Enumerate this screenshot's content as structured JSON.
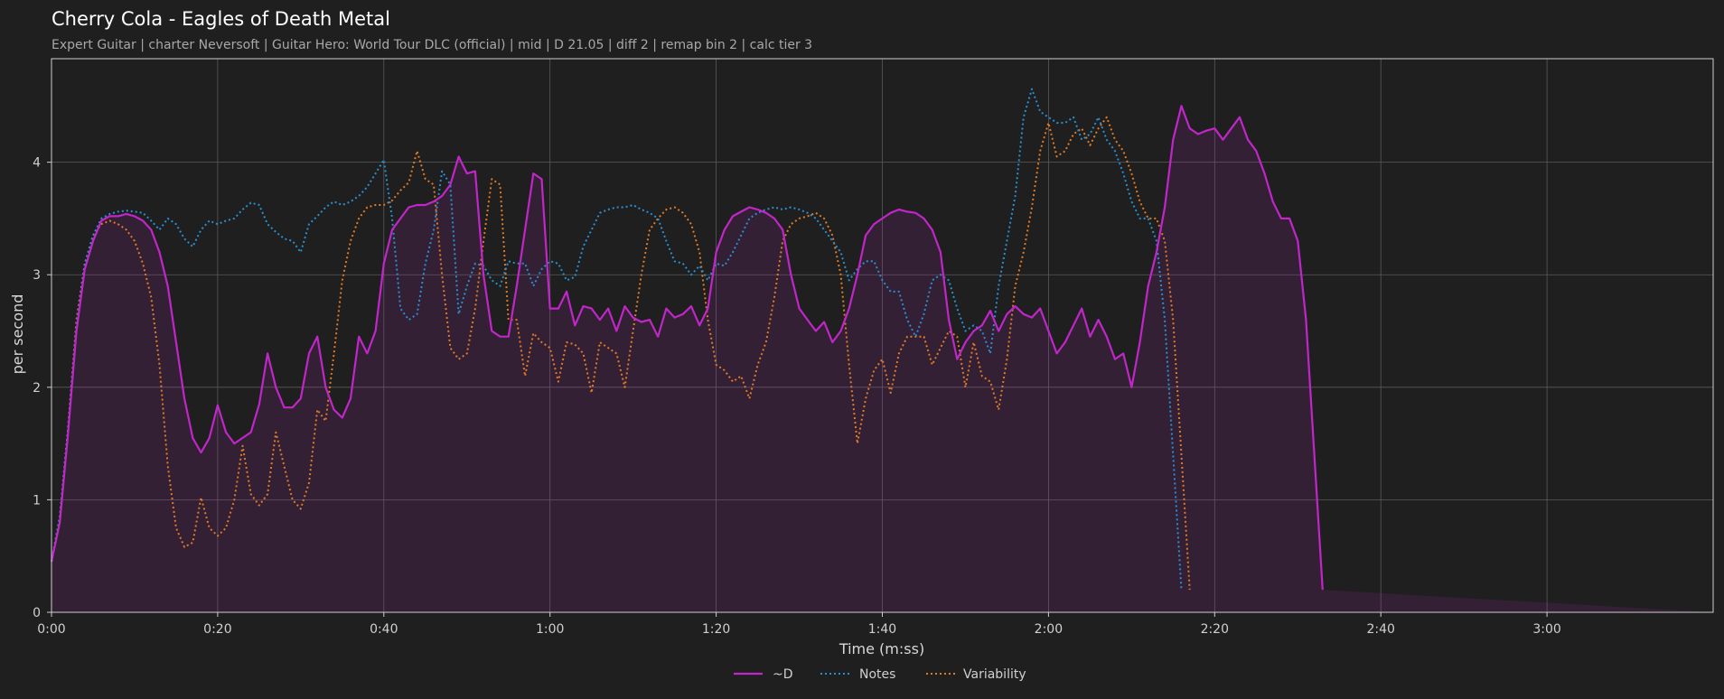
{
  "chart_data": {
    "type": "line",
    "title": "Cherry Cola - Eagles of Death Metal",
    "subtitle": "Expert Guitar  |  charter Neversoft  |  Guitar Hero: World Tour DLC (official)  |  mid  |  D 21.05  |  diff 2  |  remap bin 2  |  calc tier 3",
    "xlabel": "Time (m:ss)",
    "ylabel": "per second",
    "xlim": [
      0,
      200
    ],
    "ylim": [
      0,
      4.92
    ],
    "xticks": [
      0,
      20,
      40,
      60,
      80,
      100,
      120,
      140,
      160,
      180
    ],
    "xtick_labels": [
      "0:00",
      "0:20",
      "0:40",
      "1:00",
      "1:20",
      "1:40",
      "2:00",
      "2:20",
      "2:40",
      "3:00"
    ],
    "yticks": [
      0,
      1,
      2,
      3,
      4
    ],
    "ytick_labels": [
      "0",
      "1",
      "2",
      "3",
      "4"
    ],
    "grid": true,
    "legend_position": "bottom-center",
    "x": [
      0,
      1,
      2,
      3,
      4,
      5,
      6,
      7,
      8,
      9,
      10,
      11,
      12,
      13,
      14,
      15,
      16,
      17,
      18,
      19,
      20,
      21,
      22,
      23,
      24,
      25,
      26,
      27,
      28,
      29,
      30,
      31,
      32,
      33,
      34,
      35,
      36,
      37,
      38,
      39,
      40,
      41,
      42,
      43,
      44,
      45,
      46,
      47,
      48,
      49,
      50,
      51,
      52,
      53,
      54,
      55,
      56,
      57,
      58,
      59,
      60,
      61,
      62,
      63,
      64,
      65,
      66,
      67,
      68,
      69,
      70,
      71,
      72,
      73,
      74,
      75,
      76,
      77,
      78,
      79,
      80,
      81,
      82,
      83,
      84,
      85,
      86,
      87,
      88,
      89,
      90,
      91,
      92,
      93,
      94,
      95,
      96,
      97,
      98,
      99,
      100,
      101,
      102,
      103,
      104,
      105,
      106,
      107,
      108,
      109,
      110,
      111,
      112,
      113,
      114,
      115,
      116,
      117,
      118,
      119,
      120,
      121,
      122,
      123,
      124,
      125,
      126,
      127,
      128,
      129,
      130,
      131,
      132,
      133,
      134,
      135,
      136,
      137,
      138,
      139,
      140,
      141,
      142,
      143,
      144,
      145,
      146,
      147,
      148,
      149,
      150,
      151,
      152,
      153,
      154,
      155,
      156,
      157,
      158,
      159,
      160,
      161,
      162,
      163,
      164,
      165,
      166,
      167,
      168,
      169,
      170,
      171,
      172,
      173,
      174,
      175,
      176,
      177,
      178,
      179,
      180,
      181,
      182,
      183,
      184,
      185,
      186,
      187,
      188,
      189,
      190,
      191,
      192,
      193,
      194,
      195,
      196,
      197,
      198,
      199,
      200
    ],
    "series": [
      {
        "name": "~D",
        "color": "#c026c8",
        "style": "solid",
        "values": [
          0.45,
          0.8,
          1.6,
          2.5,
          3.05,
          3.3,
          3.48,
          3.52,
          3.52,
          3.54,
          3.52,
          3.48,
          3.4,
          3.2,
          2.9,
          2.4,
          1.9,
          1.55,
          1.42,
          1.55,
          1.84,
          1.6,
          1.5,
          1.55,
          1.6,
          1.85,
          2.3,
          2.0,
          1.82,
          1.82,
          1.9,
          2.3,
          2.45,
          2.0,
          1.8,
          1.73,
          1.9,
          2.45,
          2.3,
          2.5,
          3.1,
          3.4,
          3.5,
          3.6,
          3.62,
          3.62,
          3.65,
          3.7,
          3.8,
          4.05,
          3.9,
          3.92,
          3.0,
          2.5,
          2.45,
          2.45,
          2.9,
          3.4,
          3.9,
          3.85,
          2.7,
          2.7,
          2.85,
          2.55,
          2.72,
          2.7,
          2.6,
          2.7,
          2.5,
          2.72,
          2.62,
          2.58,
          2.6,
          2.45,
          2.7,
          2.62,
          2.65,
          2.72,
          2.55,
          2.7,
          3.2,
          3.4,
          3.52,
          3.56,
          3.6,
          3.58,
          3.55,
          3.5,
          3.4,
          3.0,
          2.7,
          2.6,
          2.5,
          2.58,
          2.4,
          2.5,
          2.7,
          3.0,
          3.35,
          3.45,
          3.5,
          3.55,
          3.58,
          3.56,
          3.55,
          3.5,
          3.4,
          3.2,
          2.6,
          2.25,
          2.4,
          2.5,
          2.55,
          2.68,
          2.5,
          2.65,
          2.72,
          2.65,
          2.62,
          2.7,
          2.5,
          2.3,
          2.4,
          2.55,
          2.7,
          2.45,
          2.6,
          2.45,
          2.25,
          2.3,
          2.0,
          2.4,
          2.9,
          3.2,
          3.6,
          4.2,
          4.5,
          4.3,
          4.25,
          4.28,
          4.3,
          4.2,
          4.3,
          4.4,
          4.2,
          4.1,
          3.9,
          3.65,
          3.5,
          3.5,
          3.3,
          2.6,
          1.4,
          0.2
        ]
      },
      {
        "name": "Notes",
        "color": "#2a8fd0",
        "style": "dotted",
        "values": [
          0.45,
          0.85,
          1.65,
          2.55,
          3.1,
          3.35,
          3.5,
          3.54,
          3.56,
          3.57,
          3.56,
          3.55,
          3.48,
          3.4,
          3.5,
          3.45,
          3.32,
          3.25,
          3.4,
          3.48,
          3.45,
          3.48,
          3.5,
          3.58,
          3.64,
          3.62,
          3.45,
          3.38,
          3.32,
          3.3,
          3.2,
          3.45,
          3.52,
          3.6,
          3.65,
          3.62,
          3.65,
          3.7,
          3.78,
          3.9,
          4.02,
          3.5,
          2.7,
          2.6,
          2.65,
          3.1,
          3.4,
          3.92,
          3.8,
          2.65,
          2.9,
          3.1,
          3.08,
          2.95,
          2.9,
          3.12,
          3.1,
          3.1,
          2.9,
          3.05,
          3.12,
          3.1,
          2.95,
          2.98,
          3.25,
          3.4,
          3.55,
          3.58,
          3.6,
          3.6,
          3.62,
          3.58,
          3.55,
          3.5,
          3.3,
          3.12,
          3.1,
          3.0,
          3.08,
          2.95,
          3.1,
          3.08,
          3.2,
          3.35,
          3.5,
          3.55,
          3.58,
          3.6,
          3.58,
          3.6,
          3.58,
          3.55,
          3.5,
          3.4,
          3.3,
          3.2,
          2.95,
          3.05,
          3.12,
          3.12,
          2.95,
          2.85,
          2.85,
          2.6,
          2.45,
          2.65,
          2.95,
          3.0,
          2.95,
          2.7,
          2.5,
          2.55,
          2.5,
          2.3,
          2.9,
          3.3,
          3.7,
          4.4,
          4.65,
          4.45,
          4.4,
          4.35,
          4.35,
          4.4,
          4.2,
          4.25,
          4.4,
          4.2,
          4.1,
          3.9,
          3.65,
          3.5,
          3.5,
          3.3,
          2.6,
          1.4,
          0.2
        ]
      },
      {
        "name": "Variability",
        "color": "#e07a26",
        "style": "dotted",
        "values": [
          0.45,
          0.85,
          1.65,
          2.6,
          3.1,
          3.35,
          3.45,
          3.48,
          3.45,
          3.4,
          3.3,
          3.1,
          2.8,
          2.2,
          1.3,
          0.75,
          0.58,
          0.62,
          1.02,
          0.75,
          0.68,
          0.75,
          1.0,
          1.48,
          1.05,
          0.95,
          1.05,
          1.6,
          1.3,
          1.0,
          0.92,
          1.15,
          1.8,
          1.7,
          2.3,
          2.95,
          3.3,
          3.5,
          3.6,
          3.62,
          3.62,
          3.66,
          3.75,
          3.82,
          4.1,
          3.85,
          3.8,
          3.0,
          2.35,
          2.25,
          2.3,
          2.7,
          3.3,
          3.85,
          3.8,
          2.6,
          2.6,
          2.1,
          2.48,
          2.4,
          2.35,
          2.05,
          2.4,
          2.38,
          2.3,
          1.95,
          2.4,
          2.35,
          2.3,
          2.0,
          2.5,
          3.0,
          3.4,
          3.5,
          3.58,
          3.6,
          3.55,
          3.45,
          3.2,
          2.6,
          2.2,
          2.15,
          2.05,
          2.1,
          1.9,
          2.2,
          2.4,
          2.8,
          3.3,
          3.45,
          3.5,
          3.52,
          3.55,
          3.5,
          3.35,
          3.0,
          2.2,
          1.5,
          1.9,
          2.15,
          2.25,
          1.95,
          2.3,
          2.45,
          2.45,
          2.45,
          2.2,
          2.35,
          2.5,
          2.45,
          2.0,
          2.4,
          2.1,
          2.05,
          1.8,
          2.25,
          2.9,
          3.2,
          3.6,
          4.1,
          4.35,
          4.05,
          4.1,
          4.25,
          4.3,
          4.15,
          4.3,
          4.4,
          4.2,
          4.1,
          3.9,
          3.65,
          3.5,
          3.5,
          3.3,
          2.6,
          1.4,
          0.2
        ]
      }
    ]
  },
  "legend": {
    "items": [
      {
        "label": "~D"
      },
      {
        "label": "Notes"
      },
      {
        "label": "Variability"
      }
    ]
  }
}
